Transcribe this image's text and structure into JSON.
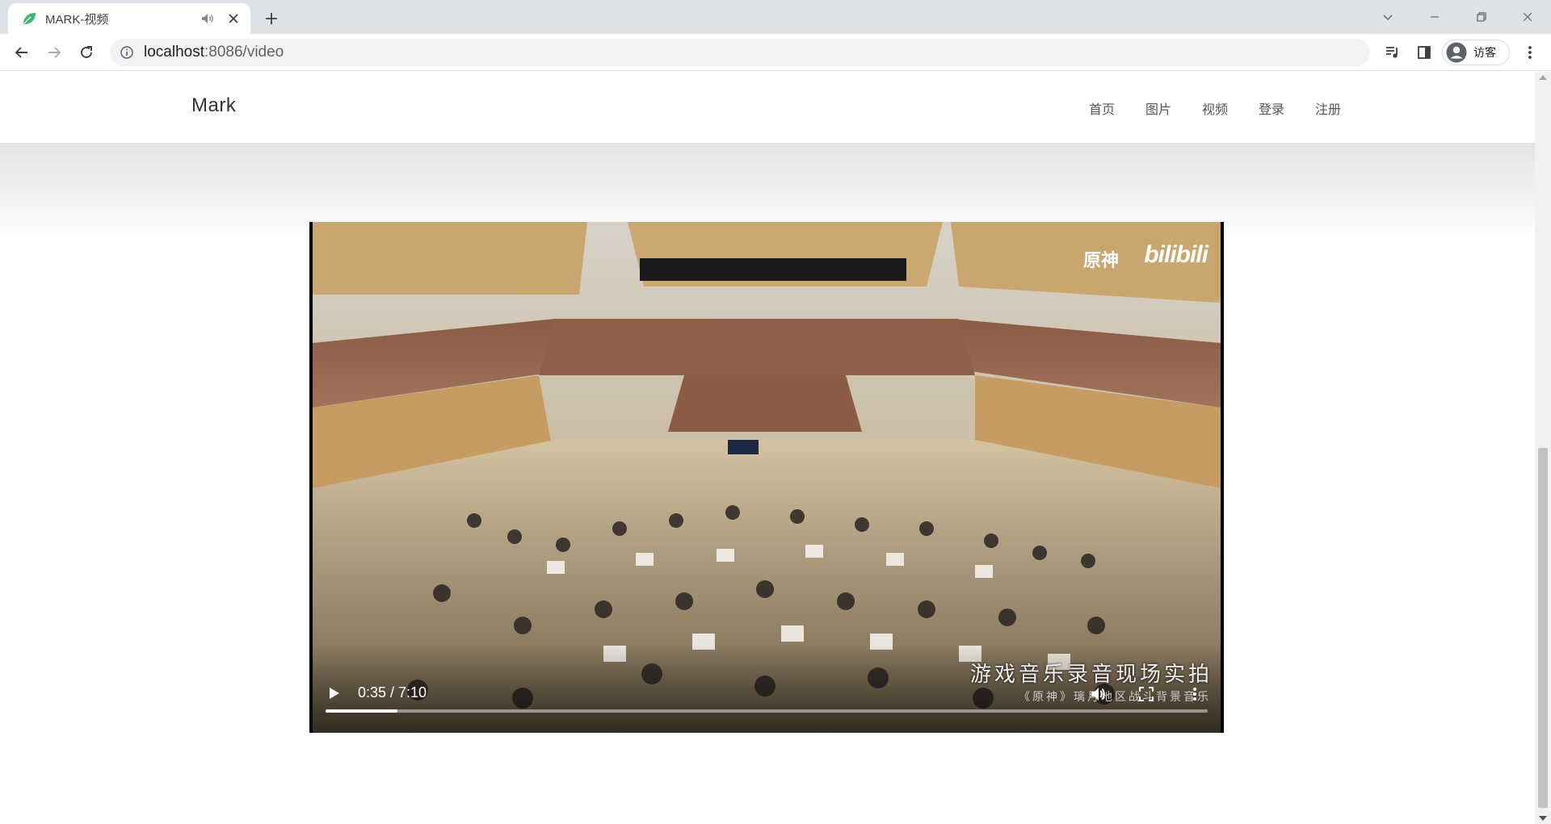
{
  "browser": {
    "tab_title": "MARK-视频",
    "url_host": "localhost",
    "url_rest": ":8086/video",
    "profile_label": "访客"
  },
  "site": {
    "brand": "Mark",
    "nav": [
      "首页",
      "图片",
      "视频",
      "登录",
      "注册"
    ]
  },
  "video": {
    "current_time": "0:35",
    "duration": "7:10",
    "time_display": "0:35 / 7:10",
    "progress_fraction": 0.0814,
    "watermark_text": "原神",
    "watermark_logo": "bilibili",
    "caption_main": "游戏音乐录音现场实拍",
    "caption_sub": "《原神》璃月地区战斗背景音乐"
  },
  "colors": {
    "tabstrip": "#dee1e6",
    "omnibox": "#f1f3f4",
    "accent_leaf": "#34a853"
  }
}
